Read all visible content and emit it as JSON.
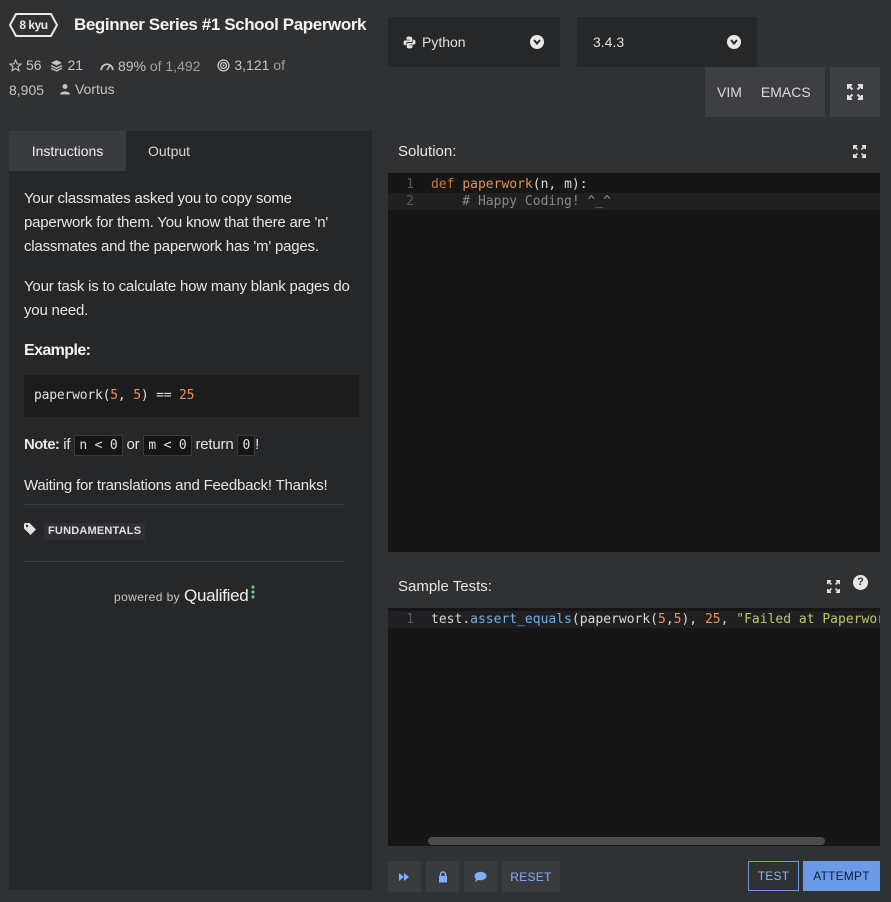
{
  "kata": {
    "rank": "8 kyu",
    "title": "Beginner Series #1 School Paperwork",
    "stars": "56",
    "collections": "21",
    "satisfaction": "89%",
    "satisfaction_of": "of 1,492",
    "completed": "3,121",
    "completed_of": "of",
    "completed_total": "8,905",
    "author": "Vortus"
  },
  "toolbar": {
    "language": "Python",
    "version": "3.4.3",
    "mode_vim": "VIM",
    "mode_emacs": "EMACS"
  },
  "tabs": {
    "instructions": "Instructions",
    "output": "Output"
  },
  "description": {
    "p1": "Your classmates asked you to copy some paperwork for them. You know that there are 'n' classmates and the paperwork has 'm' pages.",
    "p2": "Your task is to calculate how many blank pages do you need.",
    "example_heading": "Example:",
    "example_fn": "paperwork(",
    "example_a": "5",
    "example_sep": ", ",
    "example_b": "5",
    "example_close": ") == ",
    "example_result": "25",
    "note_label": "Note:",
    "note_if": " if ",
    "note_code1": "n < 0",
    "note_or": " or ",
    "note_code2": "m < 0",
    "note_return": " return ",
    "note_code3": "0",
    "note_end": "!",
    "p3": "Waiting for translations and Feedback! Thanks!",
    "tag": "FUNDAMENTALS",
    "powered_by": "powered by",
    "brand": "Qualified"
  },
  "solution": {
    "label": "Solution:",
    "line1_num": "1",
    "line1_kw": "def",
    "line1_fn": "paperwork",
    "line1_rest": "(n, m):",
    "line2_num": "2",
    "line2_text": "    # Happy Coding! ^_^"
  },
  "tests": {
    "label": "Sample Tests:",
    "help": "?",
    "line1_num": "1",
    "obj": "test",
    "dot": ".",
    "method": "assert_equals",
    "open": "(paperwork(",
    "a": "5",
    "comma": ",",
    "b": "5",
    "close": "), ",
    "expected": "25",
    "sep": ", ",
    "msg": "\"Failed at Paperwork\")"
  },
  "actions": {
    "reset": "RESET",
    "test": "TEST",
    "attempt": "ATTEMPT"
  },
  "colors": {
    "accent": "#6a9ae8",
    "background": "#303133",
    "panel": "#262729",
    "editor": "#161617"
  }
}
